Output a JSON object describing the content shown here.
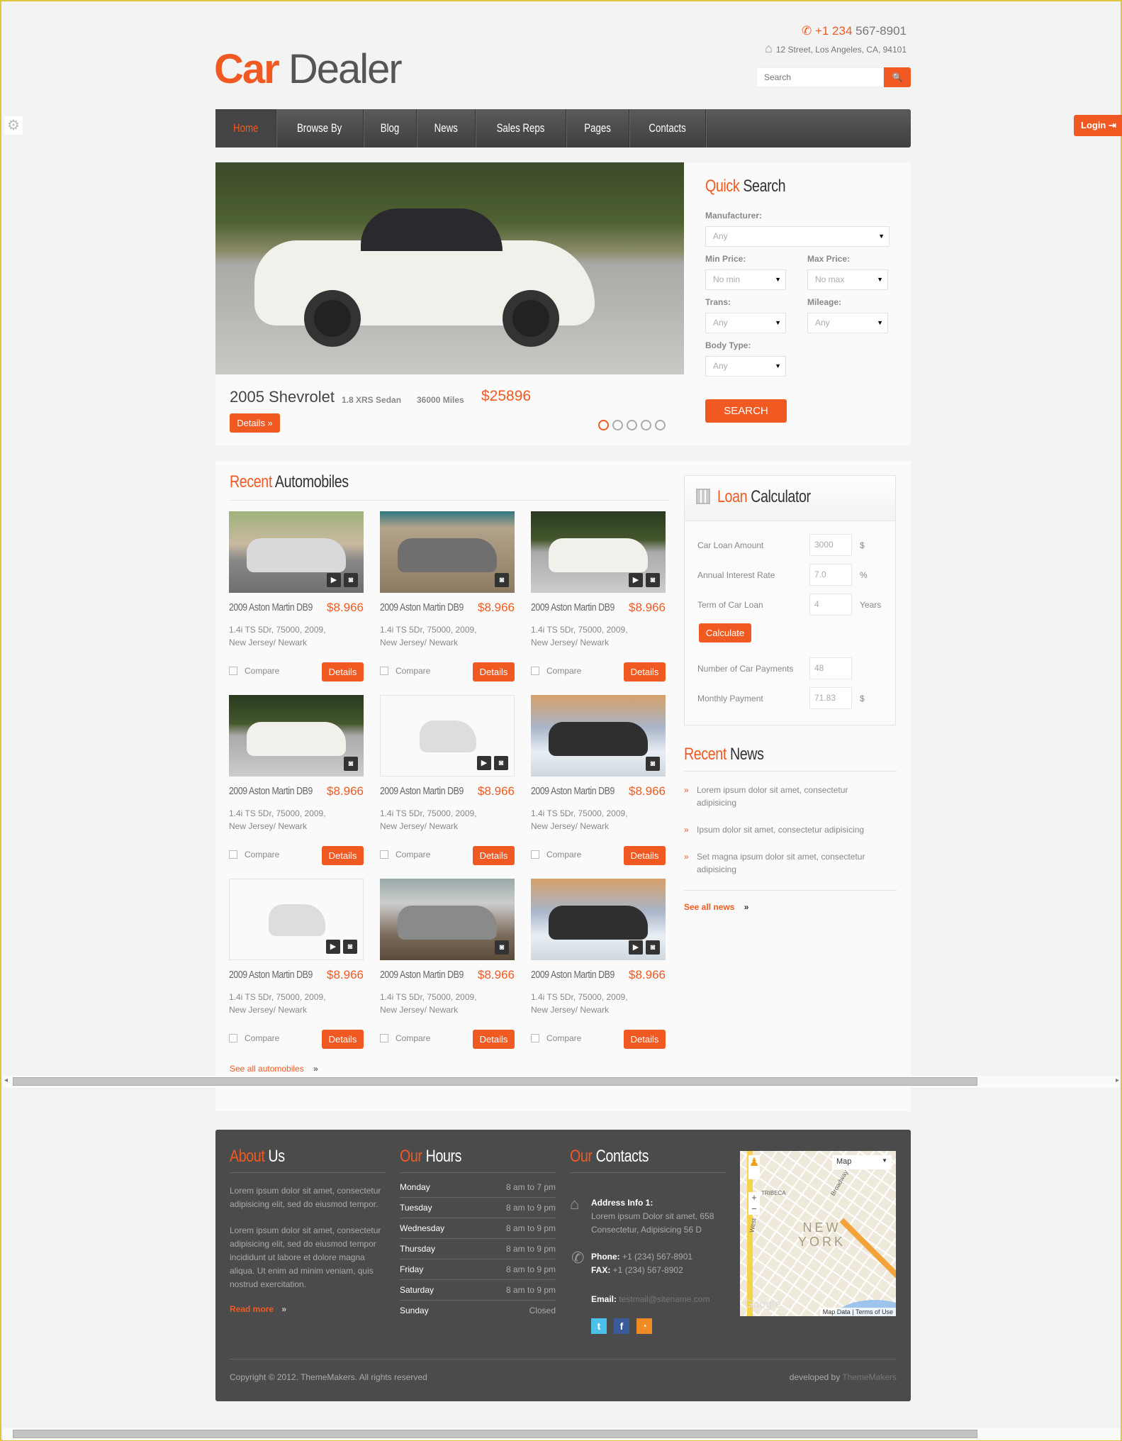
{
  "brand": {
    "logo_a": "Car",
    "logo_b": " Dealer"
  },
  "header": {
    "phone_a": "+1 234",
    "phone_b": " 567-8901",
    "address": "12 Street, Los Angeles, CA, 94101",
    "search_placeholder": "Search"
  },
  "nav": [
    "Home",
    "Browse By",
    "Blog",
    "News",
    "Sales Reps",
    "Pages",
    "Contacts"
  ],
  "login": "Login",
  "slider": {
    "title": "2005 Shevrolet",
    "trim": "1.8 XRS Sedan",
    "miles": "36000 Miles",
    "price": "$25896",
    "details": "Details »",
    "slides": 5,
    "active": 1
  },
  "quick_search": {
    "title_a": "Quick",
    "title_b": " Search",
    "manufacturer": "Manufacturer:",
    "manufacturer_val": "Any",
    "min_price": "Min Price:",
    "min_val": "No min",
    "max_price": "Max Price:",
    "max_val": "No max",
    "trans": "Trans:",
    "trans_val": "Any",
    "mileage": "Mileage:",
    "mileage_val": "Any",
    "body": "Body Type:",
    "body_val": "Any",
    "button": "SEARCH"
  },
  "recent": {
    "title_a": "Recent",
    "title_b": " Automobiles",
    "see_all": "See all automobiles",
    "cars": [
      {
        "title": "2009 Aston Martin DB9",
        "price": "$8.966",
        "desc1": "1.4i TS 5Dr,  75000,  2009,",
        "desc2": "New Jersey/ Newark",
        "compare": "Compare",
        "details": "Details",
        "video": true,
        "img": "silver"
      },
      {
        "title": "2009 Aston Martin DB9",
        "price": "$8.966",
        "desc1": "1.4i TS 5Dr,  75000,  2009,",
        "desc2": "New Jersey/ Newark",
        "compare": "Compare",
        "details": "Details",
        "video": false,
        "img": "suv-grey"
      },
      {
        "title": "2009 Aston Martin DB9",
        "price": "$8.966",
        "desc1": "1.4i TS 5Dr,  75000,  2009,",
        "desc2": "New Jersey/ Newark",
        "compare": "Compare",
        "details": "Details",
        "video": true,
        "img": "white"
      },
      {
        "title": "2009 Aston Martin DB9",
        "price": "$8.966",
        "desc1": "1.4i TS 5Dr,  75000,  2009,",
        "desc2": "New Jersey/ Newark",
        "compare": "Compare",
        "details": "Details",
        "video": false,
        "img": "white"
      },
      {
        "title": "2009 Aston Martin DB9",
        "price": "$8.966",
        "desc1": "1.4i TS 5Dr,  75000,  2009,",
        "desc2": "New Jersey/ Newark",
        "compare": "Compare",
        "details": "Details",
        "video": true,
        "img": "placeholder"
      },
      {
        "title": "2009 Aston Martin DB9",
        "price": "$8.966",
        "desc1": "1.4i TS 5Dr,  75000,  2009,",
        "desc2": "New Jersey/ Newark",
        "compare": "Compare",
        "details": "Details",
        "video": false,
        "img": "suv-dark"
      },
      {
        "title": "2009 Aston Martin DB9",
        "price": "$8.966",
        "desc1": "1.4i TS 5Dr,  75000,  2009,",
        "desc2": "New Jersey/ Newark",
        "compare": "Compare",
        "details": "Details",
        "video": true,
        "img": "placeholder"
      },
      {
        "title": "2009 Aston Martin DB9",
        "price": "$8.966",
        "desc1": "1.4i TS 5Dr,  75000,  2009,",
        "desc2": "New Jersey/ Newark",
        "compare": "Compare",
        "details": "Details",
        "video": false,
        "img": "pickup"
      },
      {
        "title": "2009 Aston Martin DB9",
        "price": "$8.966",
        "desc1": "1.4i TS 5Dr,  75000,  2009,",
        "desc2": "New Jersey/ Newark",
        "compare": "Compare",
        "details": "Details",
        "video": true,
        "img": "suv-dark"
      }
    ]
  },
  "loan": {
    "title_a": "Loan",
    "title_b": " Calculator",
    "amount_label": "Car Loan Amount",
    "amount": "3000",
    "amount_unit": "$",
    "rate_label": "Annual Interest Rate",
    "rate": "7.0",
    "rate_unit": "%",
    "term_label": "Term of Car Loan",
    "term": "4",
    "term_unit": "Years",
    "calculate": "Calculate",
    "payments_label": "Number of Car Payments",
    "payments": "48",
    "monthly_label": "Monthly Payment",
    "monthly": "71.83",
    "monthly_unit": "$"
  },
  "news": {
    "title_a": "Recent",
    "title_b": " News",
    "items": [
      "Lorem ipsum dolor sit amet, consectetur adipisicing",
      "Ipsum dolor sit amet, consectetur adipisicing",
      "Set magna ipsum dolor sit amet, consectetur adipisicing"
    ],
    "see_all": "See all news"
  },
  "footer": {
    "about": {
      "title_a": "About",
      "title_b": " Us",
      "p1": "Lorem ipsum dolor sit amet, consectetur adipisicing elit, sed do eiusmod tempor.",
      "p2": "Lorem ipsum dolor sit amet, consectetur adipisicing elit, sed do eiusmod tempor incididunt ut labore et dolore magna aliqua. Ut enim ad minim veniam, quis nostrud exercitation.",
      "read_more": "Read more"
    },
    "hours": {
      "title_a": "Our",
      "title_b": " Hours",
      "rows": [
        [
          "Monday",
          "8 am to 7 pm"
        ],
        [
          "Tuesday",
          "8 am to 9 pm"
        ],
        [
          "Wednesday",
          "8 am to 9 pm"
        ],
        [
          "Thursday",
          "8 am to 9 pm"
        ],
        [
          "Friday",
          "8 am to 9 pm"
        ],
        [
          "Saturday",
          "8 am to 9 pm"
        ],
        [
          "Sunday",
          "Closed"
        ]
      ]
    },
    "contacts": {
      "title_a": "Our",
      "title_b": " Contacts",
      "addr_label": "Address Info 1:",
      "addr1": "Lorem ipsum Dolor sit amet, 658",
      "addr2": "Consectetur, Adipisicing 56 D",
      "phone_label": "Phone:",
      "phone": " +1 (234) 567-8901",
      "fax_label": "FAX:",
      "fax": " +1 (234) 567-8902",
      "email_label": "Email:",
      "email": " testmail@sitename.com"
    },
    "map": {
      "type": "Map",
      "city_a": "NEW",
      "city_b": "YORK",
      "area": "TRIBECA",
      "street": "Broadway",
      "street2": "West",
      "data": "Map Data",
      "terms": "Terms of Use",
      "logo": "Google"
    },
    "copyright": "Copyright © 2012. ThemeMakers. All rights reserved",
    "dev_a": "developed by ",
    "dev_b": "ThemeMakers"
  },
  "colors": {
    "accent": "#f05a22",
    "nav": "#4a4a4a",
    "footer": "#4b4b4b"
  }
}
